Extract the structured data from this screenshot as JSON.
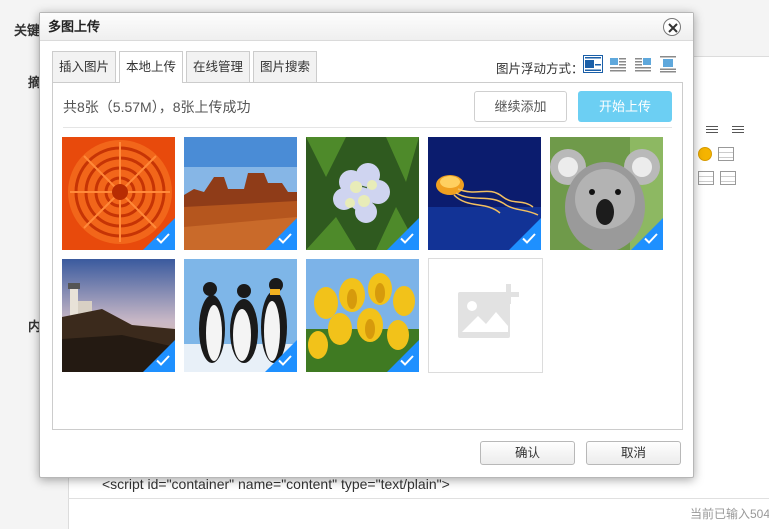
{
  "background": {
    "label_keywords": "关键",
    "label_summary": "摘",
    "label_content": "内",
    "code_line": "<script id=\"container\" name=\"content\" type=\"text/plain\">",
    "status_text": "当前已输入504"
  },
  "dialog": {
    "title": "多图上传",
    "close_icon": "close-icon",
    "tabs": [
      {
        "label": "插入图片",
        "active": false
      },
      {
        "label": "本地上传",
        "active": true
      },
      {
        "label": "在线管理",
        "active": false
      },
      {
        "label": "图片搜索",
        "active": false
      }
    ],
    "float_label": "图片浮动方式：",
    "float_options": [
      "float-none-icon",
      "float-left-icon",
      "float-right-icon",
      "float-center-icon"
    ],
    "upload": {
      "info": "共8张（5.57M），8张上传成功",
      "continue_label": "继续添加",
      "start_label": "开始上传"
    },
    "images": [
      {
        "name": "red-chrysanthemum",
        "selected": true
      },
      {
        "name": "desert-mesa",
        "selected": true
      },
      {
        "name": "hydrangea",
        "selected": true
      },
      {
        "name": "jellyfish",
        "selected": true
      },
      {
        "name": "koala",
        "selected": true
      },
      {
        "name": "lighthouse",
        "selected": true
      },
      {
        "name": "penguins",
        "selected": true
      },
      {
        "name": "tulips",
        "selected": true
      }
    ],
    "confirm_label": "确认",
    "cancel_label": "取消"
  },
  "colors": {
    "accent": "#6ccff3",
    "check": "#1e90ff"
  }
}
